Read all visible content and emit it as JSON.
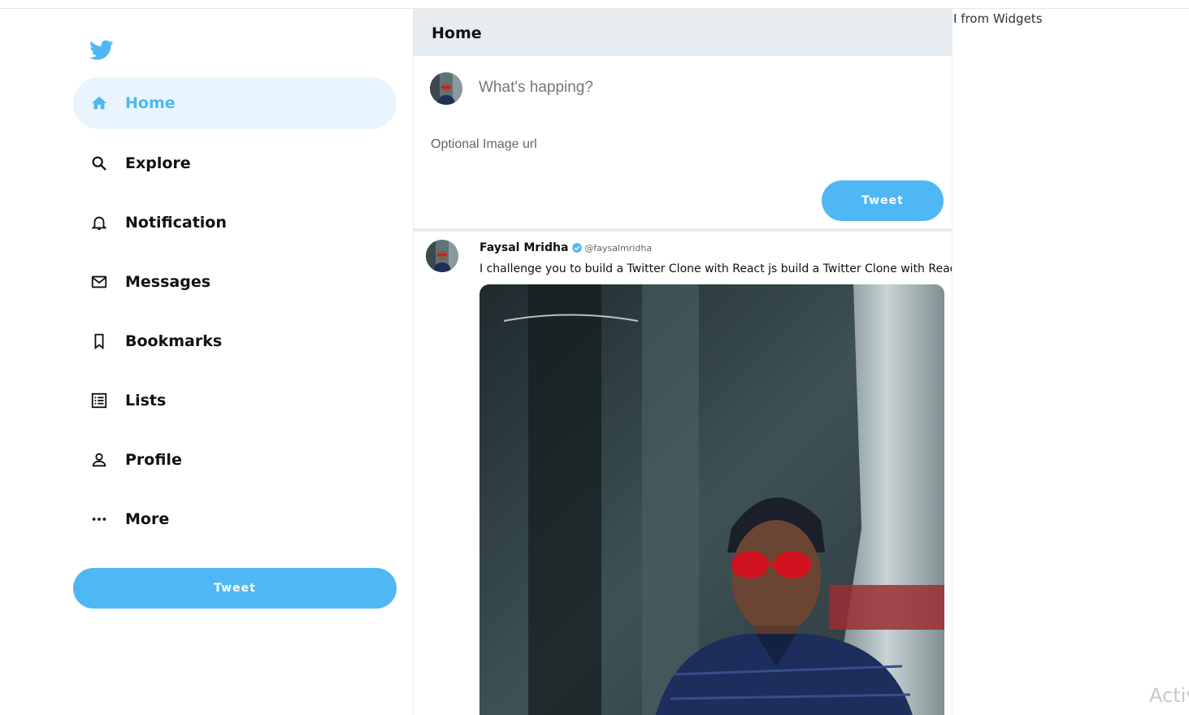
{
  "sidebar": {
    "logo_icon": "twitter-bird-icon",
    "items": [
      {
        "label": "Home",
        "icon": "home-icon",
        "active": true
      },
      {
        "label": "Explore",
        "icon": "search-icon",
        "active": false
      },
      {
        "label": "Notification",
        "icon": "bell-icon",
        "active": false
      },
      {
        "label": "Messages",
        "icon": "mail-icon",
        "active": false
      },
      {
        "label": "Bookmarks",
        "icon": "bookmark-icon",
        "active": false
      },
      {
        "label": "Lists",
        "icon": "list-icon",
        "active": false
      },
      {
        "label": "Profile",
        "icon": "person-icon",
        "active": false
      },
      {
        "label": "More",
        "icon": "more-icon",
        "active": false
      }
    ],
    "tweet_label": "Tweet"
  },
  "feed": {
    "title": "Home",
    "tweet_box": {
      "placeholder": "What's happing?",
      "image_placeholder": "Optional Image url",
      "button_label": "Tweet"
    },
    "posts": [
      {
        "display_name": "Faysal Mridha",
        "username": "@faysalmridha",
        "verified": true,
        "text": "I challenge you to build a Twitter Clone with React js build a Twitter Clone with React js"
      }
    ]
  },
  "widgets": {
    "text": "I from Widgets"
  },
  "watermark": "Activ",
  "colors": {
    "accent": "#50b7f5",
    "active_background": "#e8f5fe",
    "header_background": "#e6ecf0"
  }
}
